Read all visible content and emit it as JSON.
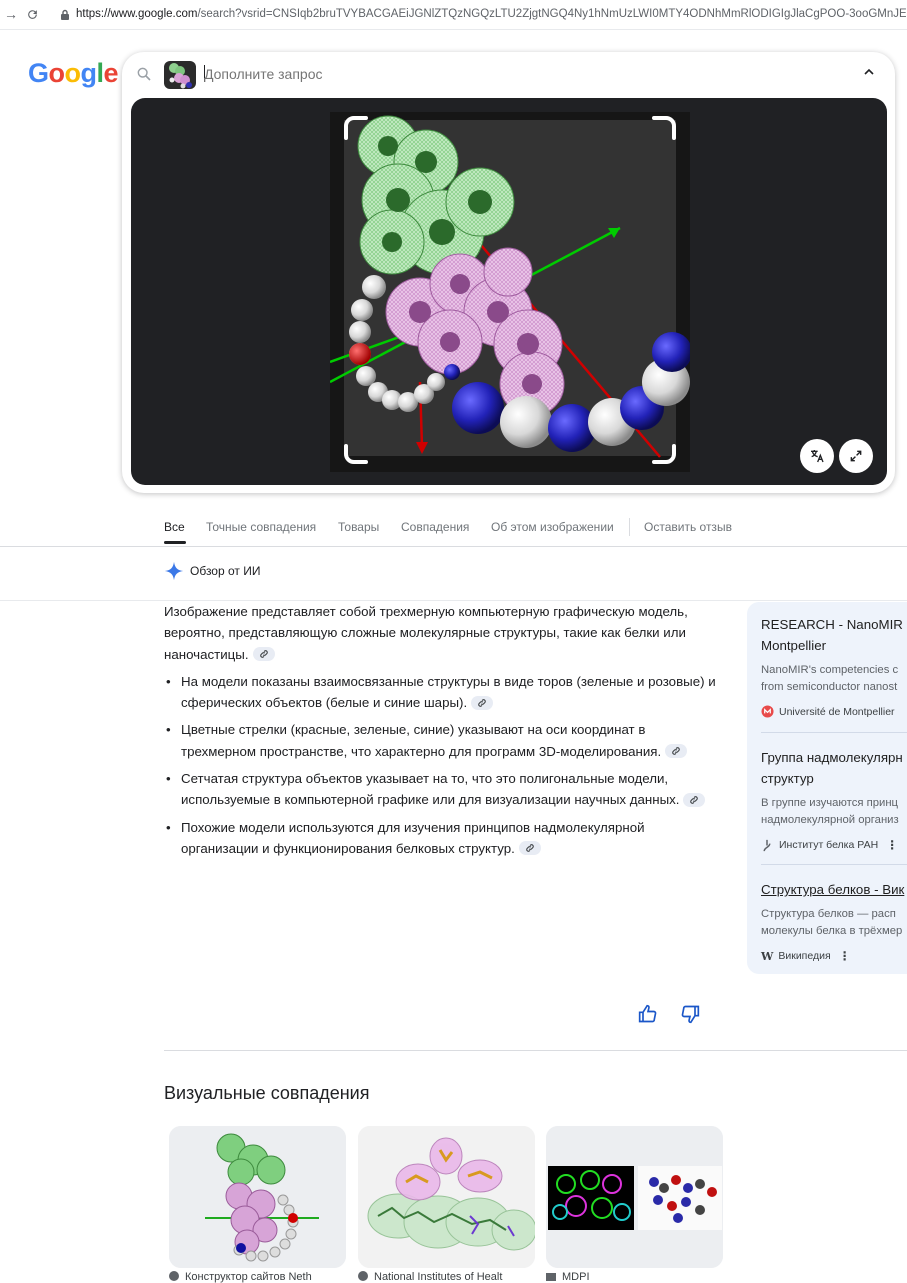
{
  "browser": {
    "url_host": "https://www.google.com",
    "url_rest": "/search?vsrid=CNSIqb2bruTVYBACGAEiJGNlZTQzNGQzLTU2ZjgtNGQ4Ny1hNmUzLWI0MTY4ODNhMmRlODIGIgJlaCgPOO-3ooGMnJED&vsint=CA"
  },
  "logo": {
    "letters": [
      "G",
      "o",
      "o",
      "g",
      "l",
      "e"
    ],
    "colors": [
      "#4285F4",
      "#EA4335",
      "#FBBC05",
      "#4285F4",
      "#34A853",
      "#EA4335"
    ]
  },
  "search": {
    "placeholder": "Дополните запрос"
  },
  "tabs": [
    {
      "label": "Все"
    },
    {
      "label": "Точные совпадения"
    },
    {
      "label": "Товары"
    },
    {
      "label": "Совпадения"
    },
    {
      "label": "Об этом изображении"
    },
    {
      "label": "Оставить отзыв"
    }
  ],
  "ai": {
    "header": "Обзор от ИИ",
    "intro": "Изображение представляет собой трехмерную компьютерную графическую модель, вероятно, представляющую сложные молекулярные структуры, такие как белки или наночастицы.",
    "bullets": [
      "На модели показаны взаимосвязанные структуры в виде торов (зеленые и розовые) и сферических объектов (белые и синие шары).",
      "Цветные стрелки (красные, зеленые, синие) указывают на оси координат в трехмерном пространстве, что характерно для программ 3D-моделирования.",
      "Сетчатая структура объектов указывает на то, что это полигональные модели, используемые в компьютерной графике или для визуализации научных данных.",
      "Похожие модели используются для изучения принципов надмолекулярной организации и функционирования белковых структур."
    ]
  },
  "sources": [
    {
      "title_1": "RESEARCH - NanoMIR",
      "title_2": "Montpellier",
      "snippet_1": "NanoMIR's competencies c",
      "snippet_2": "from semiconductor nanost",
      "site": "Université de Montpellier"
    },
    {
      "title_1": "Группа надмолекулярн",
      "title_2": "структур",
      "snippet_1": "В группе изучаются принц",
      "snippet_2": "надмолекулярной организ",
      "site": "Институт белка РАН"
    },
    {
      "title_1": "Структура белков - Вик",
      "title_2": "",
      "snippet_1": "Структура белков — расп",
      "snippet_2": "молекулы белка в трёхмер",
      "site": "Википедия"
    }
  ],
  "visual_matches": {
    "title": "Визуальные совпадения",
    "items": [
      {
        "source": "Конструктор сайтов Neth"
      },
      {
        "source": "National Institutes of Healt"
      },
      {
        "source": "MDPI"
      }
    ]
  },
  "colors": {
    "accent_blue": "#1a0dab",
    "link_blue": "#1a73e8",
    "viewer_bg": "#202124"
  }
}
